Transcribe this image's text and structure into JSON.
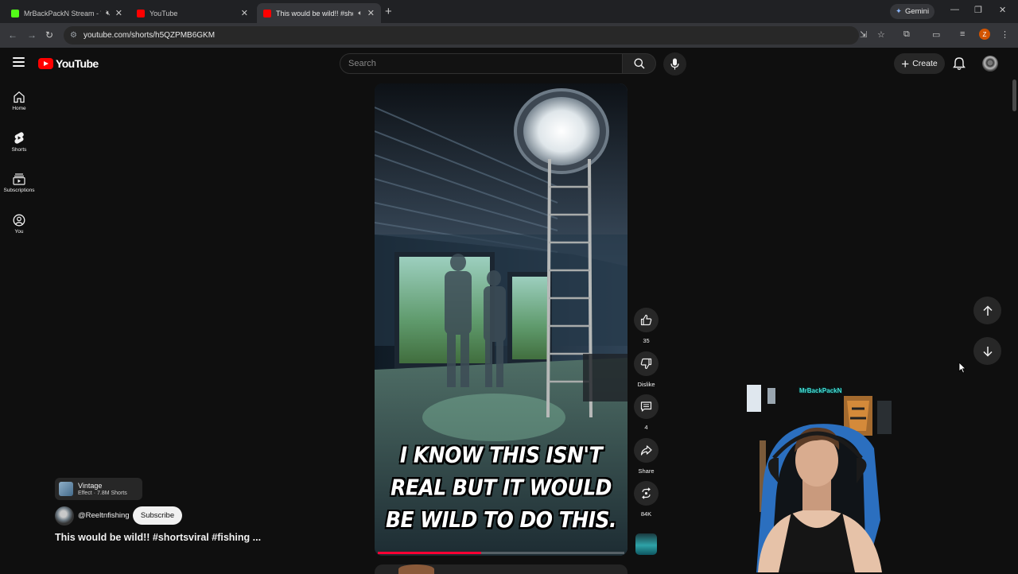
{
  "browser": {
    "tabs": [
      {
        "title": "MrBackPackN Stream - Wa",
        "favicon_color": "#53fc18",
        "muted": true,
        "active": false
      },
      {
        "title": "YouTube",
        "favicon_color": "#ff0000",
        "muted": false,
        "active": false
      },
      {
        "title": "This would be wild!! #short",
        "favicon_color": "#ff0000",
        "muted": true,
        "active": true
      }
    ],
    "gemini_label": "Gemini",
    "url": "youtube.com/shorts/h5QZPMB6GKM",
    "profile_initial": "Z"
  },
  "header": {
    "logo_text": "YouTube",
    "search_placeholder": "Search",
    "create_label": "Create"
  },
  "sidebar": {
    "items": [
      {
        "label": "Home",
        "icon": "home-icon"
      },
      {
        "label": "Shorts",
        "icon": "shorts-icon"
      },
      {
        "label": "Subscriptions",
        "icon": "subscriptions-icon"
      },
      {
        "label": "You",
        "icon": "you-icon"
      }
    ]
  },
  "short": {
    "caption": "I KNOW THIS ISN'T REAL BUT IT WOULD BE WILD TO DO THIS.",
    "progress": 0.42,
    "title": "This would be wild!! #shortsviral #fishing ...",
    "channel": "@Reeltnfishing",
    "subscribe_label": "Subscribe",
    "effect": {
      "name": "Vintage",
      "meta": "Effect · 7.8M Shorts"
    }
  },
  "actions": {
    "like_count": "35",
    "dislike_label": "Dislike",
    "comment_count": "4",
    "share_label": "Share",
    "remix_count": "84K"
  },
  "stream_overlay": {
    "streamer_name": "MrBackPackN"
  },
  "colors": {
    "background": "#0f0f0f",
    "brand_red": "#ff0000",
    "progress_red": "#ff0033",
    "overlay_cyan": "#49e1d8"
  }
}
